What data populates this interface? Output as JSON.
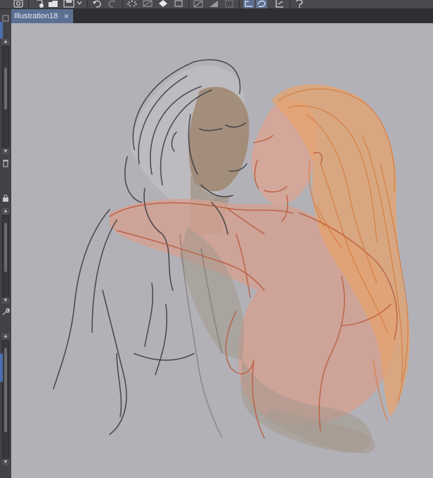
{
  "toolbar": {
    "buttons": [
      {
        "name": "app-logo-icon"
      },
      {
        "name": "new-file-icon"
      },
      {
        "name": "open-folder-icon"
      },
      {
        "name": "save-icon"
      },
      {
        "name": "dropdown-icon"
      },
      {
        "name": "undo-icon"
      },
      {
        "name": "redo-icon"
      },
      {
        "name": "loading-icon"
      },
      {
        "name": "clear-icon"
      },
      {
        "name": "fill-icon"
      },
      {
        "name": "crop-icon"
      },
      {
        "name": "transform-icon"
      },
      {
        "name": "selection-icon"
      },
      {
        "name": "lasso-select-icon"
      },
      {
        "name": "lasso-undo-icon"
      },
      {
        "name": "ruler-icon"
      },
      {
        "name": "help-icon"
      }
    ]
  },
  "tab": {
    "title": "Illustration18",
    "close": "×"
  },
  "colors": {
    "canvas": "#b2b1b7",
    "ui_dark": "#3b3b3e",
    "tab_active": "#5b6f93",
    "sketch_gray": "#3a3a40",
    "sketch_orange": "#e8a36a",
    "sketch_red": "#b85a3a",
    "skin_tan": "#a08a73",
    "skin_peach": "#d9a696"
  },
  "canvas": {
    "content": "sketch-two-figures-embracing"
  }
}
